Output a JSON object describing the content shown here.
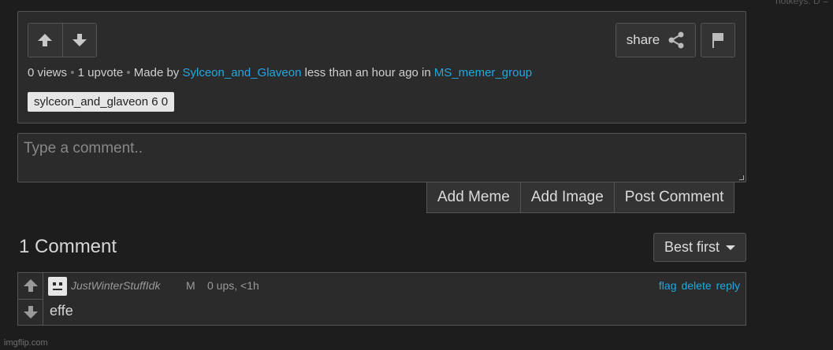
{
  "hotkeys_text": "hotkeys: D =",
  "post": {
    "share_label": "share",
    "views": "0 views",
    "upvotes": "1 upvote",
    "made_by": "Made by",
    "author": "Sylceon_and_Glaveon",
    "time": "less than an hour ago in",
    "stream": "MS_memer_group",
    "tag": "sylceon_and_glaveon 6 0"
  },
  "comment_form": {
    "placeholder": "Type a comment..",
    "add_meme": "Add Meme",
    "add_image": "Add Image",
    "post_comment": "Post Comment"
  },
  "comments_header": {
    "title": "1 Comment",
    "sort_label": "Best first"
  },
  "comment": {
    "user": "JustWinterStuffIdk",
    "mod_badge": "M",
    "stats": "0 ups, <1h",
    "flag": "flag",
    "delete": "delete",
    "reply": "reply",
    "text": "effe"
  },
  "watermark": "imgflip.com",
  "colors": {
    "link": "#23a7e0",
    "background": "#1d1d1d",
    "panel": "#2b2b2b"
  }
}
